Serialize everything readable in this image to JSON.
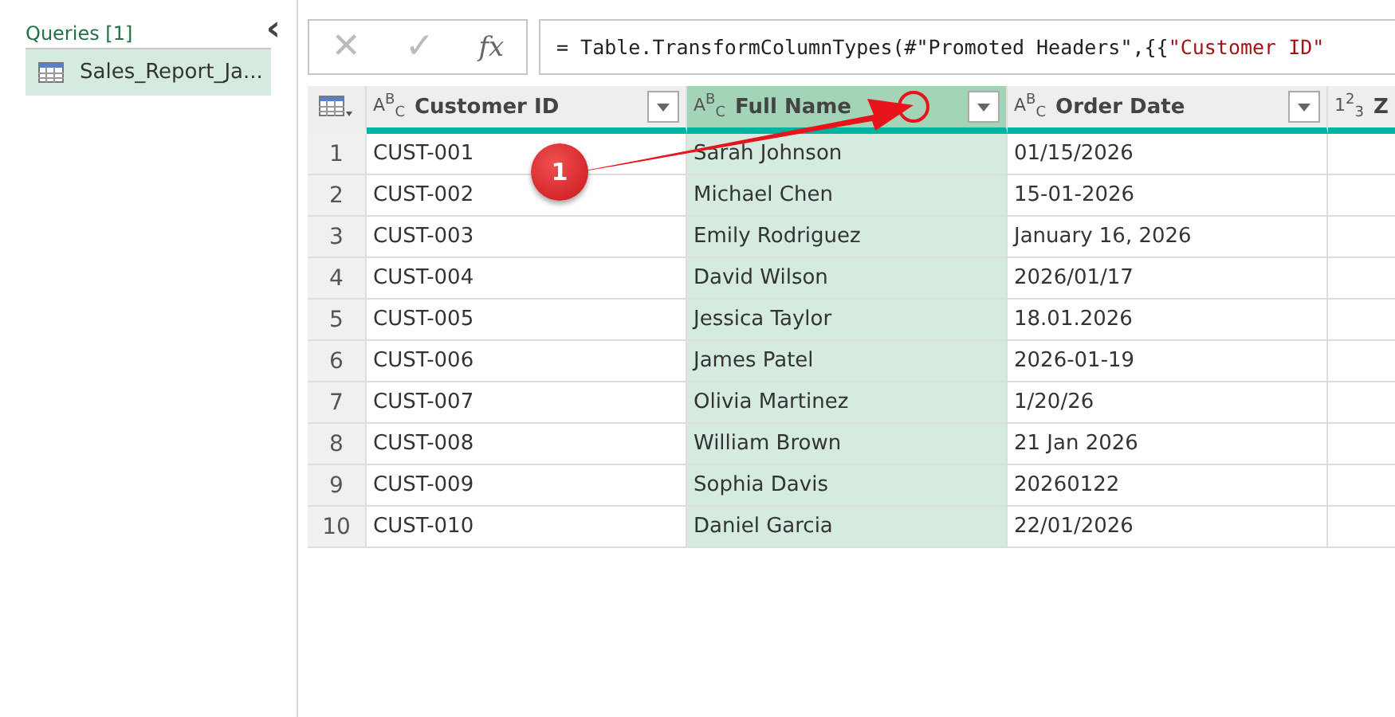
{
  "queries_panel": {
    "title": "Queries [1]",
    "collapse_icon": "‹",
    "items": [
      {
        "label": "Sales_Report_Ja...",
        "selected": true
      }
    ]
  },
  "formula_bar": {
    "cancel": "✕",
    "confirm": "✓",
    "fx": "fx",
    "formula": [
      {
        "kind": "code",
        "text": "= Table.TransformColumnTypes(#\"Promoted Headers\",{{"
      },
      {
        "kind": "string",
        "text": "\"Customer ID\""
      }
    ]
  },
  "table": {
    "columns": [
      {
        "type_icon": "A$^{B}$$_{C}$",
        "name": "Customer ID",
        "selected": false,
        "filter": true
      },
      {
        "type_icon": "A$^{B}$$_{C}$",
        "name": "Full Name",
        "selected": true,
        "filter": true
      },
      {
        "type_icon": "A$^{B}$$_{C}$",
        "name": "Order Date",
        "selected": false,
        "filter": true
      },
      {
        "type_icon": "1$^{2}$$_{3}$",
        "name": "Z",
        "selected": false,
        "filter": false
      }
    ],
    "rows": [
      {
        "number": "1",
        "cells": [
          "CUST-001",
          "Sarah Johnson",
          "01/15/2026",
          ""
        ]
      },
      {
        "number": "2",
        "cells": [
          "CUST-002",
          "Michael Chen",
          "15-01-2026",
          ""
        ]
      },
      {
        "number": "3",
        "cells": [
          "CUST-003",
          "Emily Rodriguez",
          "January 16, 2026",
          ""
        ]
      },
      {
        "number": "4",
        "cells": [
          "CUST-004",
          "David Wilson",
          "2026/01/17",
          ""
        ]
      },
      {
        "number": "5",
        "cells": [
          "CUST-005",
          "Jessica Taylor",
          "18.01.2026",
          ""
        ]
      },
      {
        "number": "6",
        "cells": [
          "CUST-006",
          "James Patel",
          "2026-01-19",
          ""
        ]
      },
      {
        "number": "7",
        "cells": [
          "CUST-007",
          "Olivia Martinez",
          "1/20/26",
          ""
        ]
      },
      {
        "number": "8",
        "cells": [
          "CUST-008",
          "William Brown",
          "21 Jan 2026",
          ""
        ]
      },
      {
        "number": "9",
        "cells": [
          "CUST-009",
          "Sophia Davis",
          "20260122",
          ""
        ]
      },
      {
        "number": "10",
        "cells": [
          "CUST-010",
          "Daniel Garcia",
          "22/01/2026",
          ""
        ]
      }
    ]
  },
  "annotation": {
    "badge": "1"
  }
}
